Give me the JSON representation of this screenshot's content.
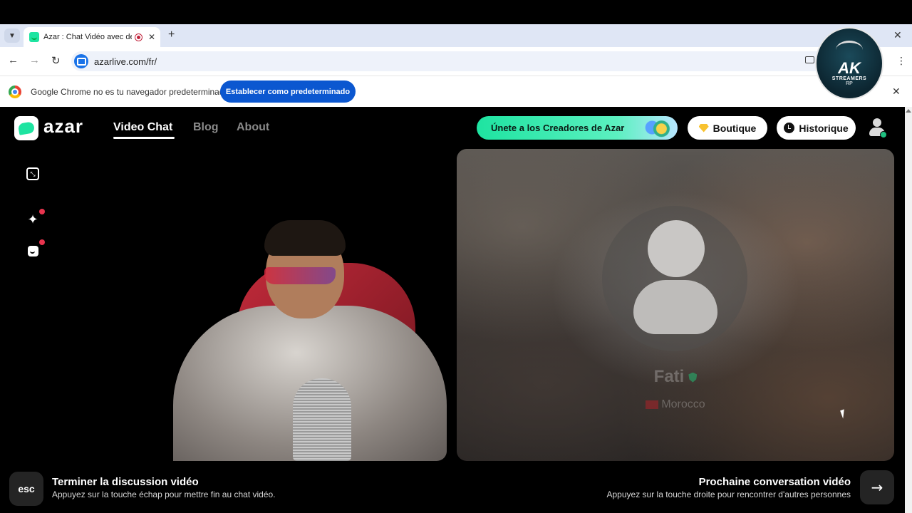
{
  "browser": {
    "tab_title": "Azar : Chat Vidéo avec de n",
    "url": "azarlive.com/fr/",
    "infobar_text": "Google Chrome no es tu navegador predeterminado",
    "infobar_button": "Establecer como predeterminado"
  },
  "overlay": {
    "logo_text": "AK",
    "logo_subtext": "STREAMERS",
    "logo_tag": "RP"
  },
  "header": {
    "brand": "azar",
    "nav": [
      "Video Chat",
      "Blog",
      "About"
    ],
    "creators_button": "Únete a los Creadores de Azar",
    "boutique_button": "Boutique",
    "history_button": "Historique"
  },
  "remote": {
    "name": "Fati",
    "country": "Morocco"
  },
  "actions": {
    "esc_key": "esc",
    "end_title": "Terminer la discussion vidéo",
    "end_desc": "Appuyez sur la touche échap pour mettre fin au chat vidéo.",
    "next_title": "Prochaine conversation vidéo",
    "next_desc": "Appuyez sur la touche droite pour rencontrer d'autres personnes",
    "next_arrow": "→"
  },
  "colors": {
    "accent": "#1ee4a1",
    "chrome_blue": "#0b57d0",
    "notification": "#e8344e"
  }
}
